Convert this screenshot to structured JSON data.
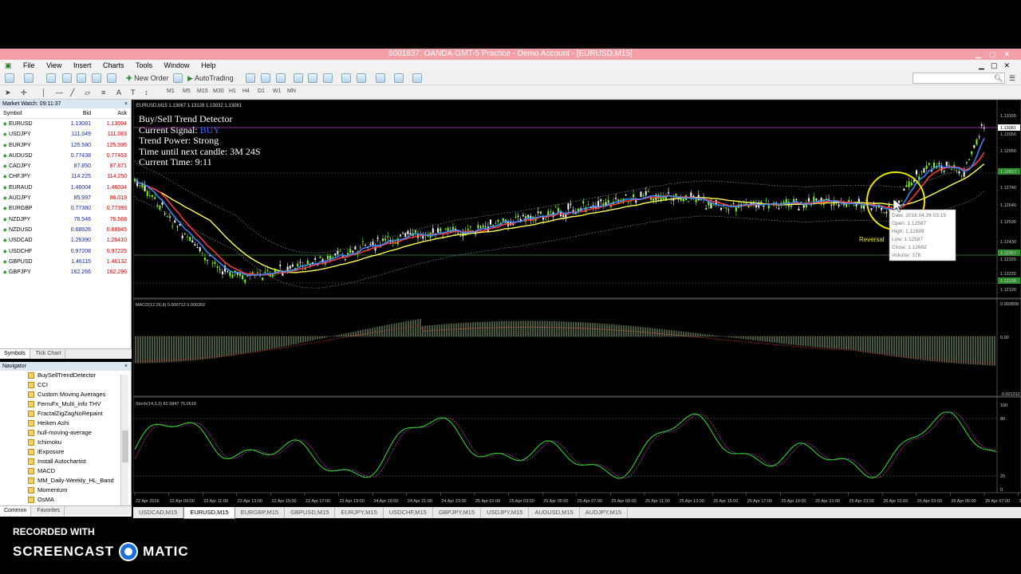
{
  "window": {
    "title": "6001837: OANDA-GMT-5 Practice - Demo Account - [EURUSD,M15]"
  },
  "menu": [
    "File",
    "View",
    "Insert",
    "Charts",
    "Tools",
    "Window",
    "Help"
  ],
  "toolbar": {
    "new_order": "New Order",
    "auto_trading": "AutoTrading",
    "timeframes": [
      "M1",
      "M5",
      "M15",
      "M30",
      "H1",
      "H4",
      "D1",
      "W1",
      "MN"
    ]
  },
  "market_watch": {
    "title": "Market Watch: 09:11:37",
    "columns": [
      "Symbol",
      "Bid",
      "Ask"
    ],
    "rows": [
      {
        "symbol": "EURUSD",
        "bid": "1.13081",
        "ask": "1.13094"
      },
      {
        "symbol": "USDJPY",
        "bid": "111.049",
        "ask": "111.063"
      },
      {
        "symbol": "EURJPY",
        "bid": "125.580",
        "ask": "125.595"
      },
      {
        "symbol": "AUDUSD",
        "bid": "0.77438",
        "ask": "0.77453"
      },
      {
        "symbol": "CADJPY",
        "bid": "87.850",
        "ask": "87.871"
      },
      {
        "symbol": "CHFJPY",
        "bid": "114.225",
        "ask": "114.250"
      },
      {
        "symbol": "EURAUD",
        "bid": "1.46004",
        "ask": "1.46034"
      },
      {
        "symbol": "AUDJPY",
        "bid": "85.997",
        "ask": "86.019"
      },
      {
        "symbol": "EURGBP",
        "bid": "0.77380",
        "ask": "0.77393"
      },
      {
        "symbol": "NZDJPY",
        "bid": "76.546",
        "ask": "76.568"
      },
      {
        "symbol": "NZDUSD",
        "bid": "0.68926",
        "ask": "0.68945"
      },
      {
        "symbol": "USDCAD",
        "bid": "1.26390",
        "ask": "1.26410"
      },
      {
        "symbol": "USDCHF",
        "bid": "0.97208",
        "ask": "0.97225"
      },
      {
        "symbol": "GBPUSD",
        "bid": "1.46115",
        "ask": "1.46132"
      },
      {
        "symbol": "GBPJPY",
        "bid": "162.266",
        "ask": "162.296"
      }
    ],
    "tabs": [
      "Symbols",
      "Tick Chart"
    ]
  },
  "navigator": {
    "title": "Navigator",
    "items": [
      "BuySellTrendDetector",
      "CCI",
      "Custom Moving Averages",
      "FerruFx_Multi_info THV",
      "FractalZigZagNoRepaint",
      "Heiken Ashi",
      "hull-moving-average",
      "Ichimoku",
      "iExposure",
      "Install Autochartist",
      "MACD",
      "MM_Daily-Weekly_HL_Band",
      "Momentum",
      "OsMA"
    ],
    "tabs": [
      "Common",
      "Favorites"
    ]
  },
  "chart": {
    "header": "EURUSD,M15  1.13067 1.13128 1.13032 1.13081",
    "info": {
      "title": "Buy/Sell Trend Detector",
      "signal_label": "Current Signal: ",
      "signal_value": "BUY",
      "power": "Trend Power: Strong",
      "next_candle": "Time until next candle: 3M 24S",
      "current_time": "Current Time: 9:11"
    },
    "price_labels": [
      "1.13155",
      "1.13081",
      "1.13050",
      "1.12950",
      "1.12817",
      "1.12740",
      "1.12640",
      "1.12535",
      "1.12430",
      "1.12357",
      "1.12325",
      "1.12225",
      "1.12198",
      "1.12120"
    ],
    "tooltip": [
      "Date: 2016.04.26 03:15",
      "Open: 1.12587",
      "High: 1.12699",
      "Low: 1.12587",
      "Close: 1.12682",
      "Volume: 378"
    ],
    "tooltip_partial_label": "Reversal",
    "macd_header": "MACD(12,26,9) 0.000712 0.000392",
    "macd_labels": [
      "0.000809",
      "0.00",
      "-0.001312"
    ],
    "stoch_header": "Stoch(14,3,3) 82.5847 75.0918",
    "stoch_labels": [
      "100",
      "80",
      "20",
      "0"
    ],
    "time_labels": [
      "22 Apr 2016",
      "22 Apr 09:00",
      "22 Apr 11:00",
      "22 Apr 13:00",
      "22 Apr 15:00",
      "22 Apr 17:00",
      "22 Apr 19:00",
      "24 Apr 19:00",
      "24 Apr 21:00",
      "24 Apr 23:00",
      "25 Apr 01:00",
      "25 Apr 03:00",
      "25 Apr 05:00",
      "25 Apr 07:00",
      "25 Apr 09:00",
      "25 Apr 11:00",
      "25 Apr 13:00",
      "25 Apr 15:00",
      "25 Apr 17:00",
      "25 Apr 19:00",
      "25 Apr 21:00",
      "25 Apr 23:00",
      "26 Apr 01:00",
      "26 Apr 03:00",
      "26 Apr 05:00",
      "26 Apr 07:00",
      "26 Apr 09:00"
    ],
    "colors": {
      "up": "#7cfc00",
      "down": "#ffffff",
      "ma_fast": "#3b8bff",
      "ma_mid": "#ff3b3b",
      "ma_slow": "#ffff55",
      "band": "#9aa",
      "stoch_main": "#2fd12f",
      "stoch_signal": "#d43fd4",
      "macd_hist": "#c8f7a0",
      "macd_signal": "#d43030",
      "highlight": "#e8e800"
    }
  },
  "chart_tabs": [
    "USDCAD,M15",
    "EURUSD,M15",
    "EURGBP,M15",
    "GBPUSD,M15",
    "EURJPY,M15",
    "USDCHF,M15",
    "GBPJPY,M15",
    "USDJPY,M15",
    "AUDUSD,M15",
    "AUDJPY,M15"
  ],
  "watermark": {
    "line1": "RECORDED WITH",
    "brand_a": "SCREENCAST",
    "brand_b": "MATIC"
  }
}
